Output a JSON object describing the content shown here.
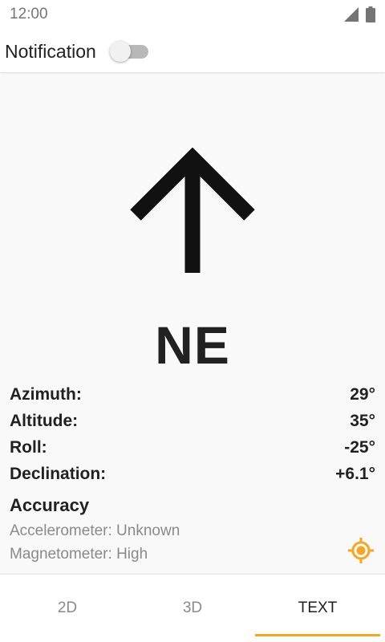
{
  "status_bar": {
    "time": "12:00",
    "icons": [
      "signal-icon",
      "battery-icon"
    ]
  },
  "notification": {
    "label": "Notification",
    "enabled": false
  },
  "compass": {
    "arrow_icon": "arrow-up-icon",
    "direction": "NE"
  },
  "readings": [
    {
      "label": "Azimuth:",
      "value": "29°"
    },
    {
      "label": "Altitude:",
      "value": "35°"
    },
    {
      "label": "Roll:",
      "value": "-25°"
    },
    {
      "label": "Declination:",
      "value": "+6.1°"
    }
  ],
  "accuracy": {
    "title": "Accuracy",
    "accelerometer": "Accelerometer: Unknown",
    "magnetometer": "Magnetometer: High",
    "locate_icon": "gps-fixed-icon"
  },
  "tabs": [
    {
      "label": "2D",
      "active": false
    },
    {
      "label": "3D",
      "active": false
    },
    {
      "label": "TEXT",
      "active": true
    }
  ],
  "colors": {
    "accent": "#f5a623",
    "text": "#212121",
    "secondary_text": "#8a8a8a"
  }
}
